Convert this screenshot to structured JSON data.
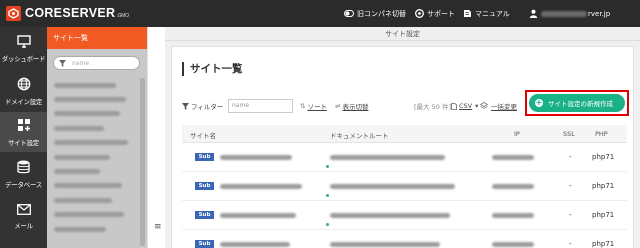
{
  "brand": {
    "name": "CORESERVER",
    "sub": ".GMO",
    "logo_color": "#e4411f"
  },
  "header": {
    "old_panel_label": "旧コンパネ切替",
    "support_label": "サポート",
    "manual_label": "マニュアル",
    "user_suffix": "rver.jp"
  },
  "rail": {
    "items": [
      {
        "label": "ダッシュボード",
        "icon": "monitor-icon"
      },
      {
        "label": "ドメイン設定",
        "icon": "globe-icon"
      },
      {
        "label": "サイト設定",
        "icon": "add-grid-icon",
        "active": true
      },
      {
        "label": "データベース",
        "icon": "database-icon"
      },
      {
        "label": "メール",
        "icon": "mail-icon"
      }
    ]
  },
  "sidebar": {
    "title": "サイト一覧",
    "search_placeholder": "name",
    "items_count_note": "blurred site names"
  },
  "main": {
    "window_title": "サイト設定",
    "page_title": "サイト一覧",
    "toolbar": {
      "filter_label": "フィルター",
      "filter_placeholder": "name",
      "sort_label": "ソート",
      "display_toggle_label": "表示切替",
      "max_note": "[最大 50 件]",
      "csv_label": "CSV",
      "batch_change_label": "一括変更",
      "new_site_button": "サイト設定の新規作成"
    },
    "table": {
      "columns": [
        "サイト名",
        "ドキュメントルート",
        "IP",
        "SSL",
        "PHP"
      ],
      "rows": [
        {
          "badge": "Sub",
          "ssl": "-",
          "php": "php71"
        },
        {
          "badge": "Sub",
          "ssl": "-",
          "php": "php71"
        },
        {
          "badge": "Sub",
          "ssl": "-",
          "php": "php71"
        },
        {
          "badge": "Sub",
          "ssl": "-",
          "php": "php71"
        }
      ]
    }
  },
  "colors": {
    "accent_orange": "#f15a22",
    "button_green": "#1ab188",
    "badge_blue": "#3a66b8",
    "highlight_red": "#e00000"
  }
}
